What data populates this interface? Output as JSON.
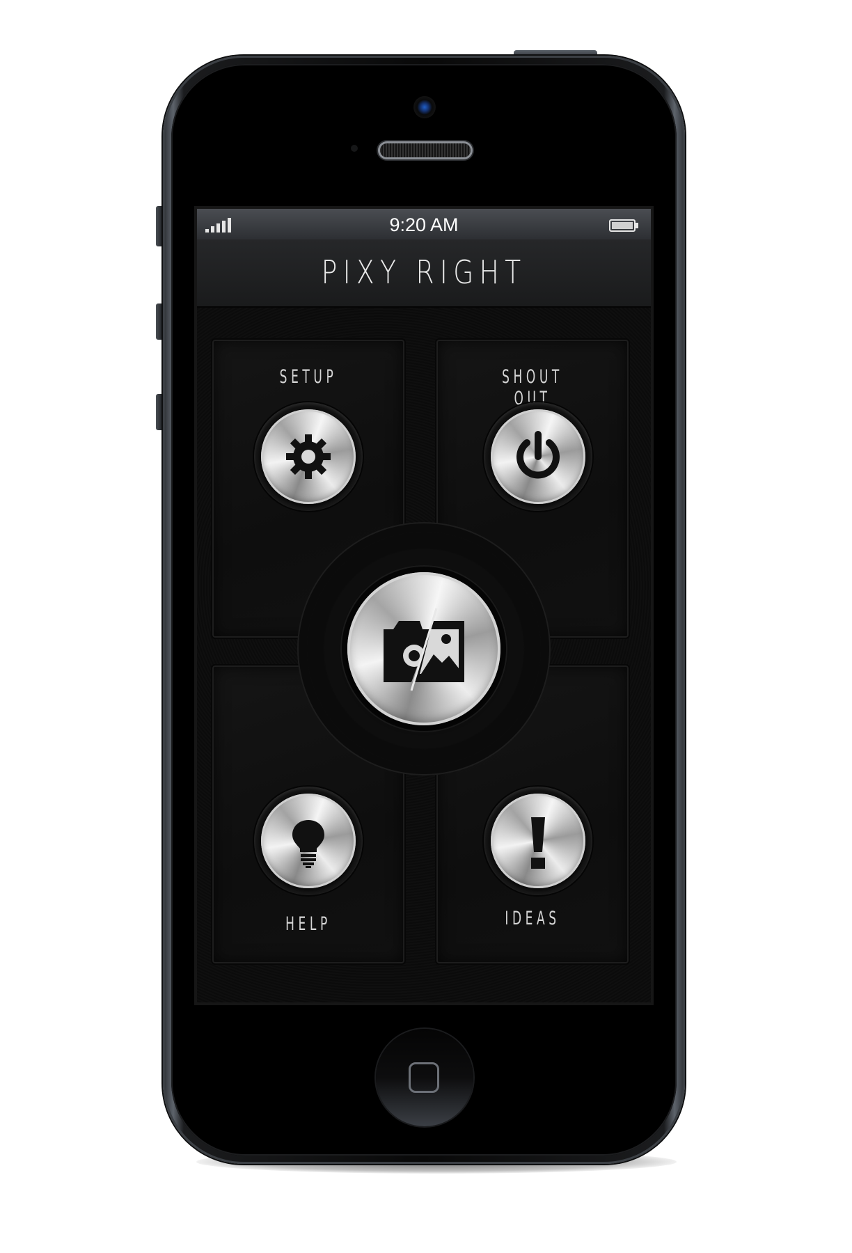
{
  "status_bar": {
    "time": "9:20 AM",
    "signal_icon": "signal-bars-icon",
    "battery_icon": "battery-icon"
  },
  "app": {
    "title": "PIXY RIGHT"
  },
  "tiles": {
    "setup": {
      "label": "SETUP",
      "icon": "gear-icon"
    },
    "shout_out": {
      "label": "SHOUT OUT",
      "icon": "power-icon"
    },
    "help": {
      "label": "HELP",
      "icon": "lightbulb-icon"
    },
    "ideas": {
      "label": "IDEAS",
      "icon": "exclamation-icon"
    }
  },
  "center_action": {
    "icon": "camera-photo-icon"
  },
  "colors": {
    "background": "#0c0c0c",
    "metal": "#d8d8d8",
    "label": "#d6d6d6"
  }
}
